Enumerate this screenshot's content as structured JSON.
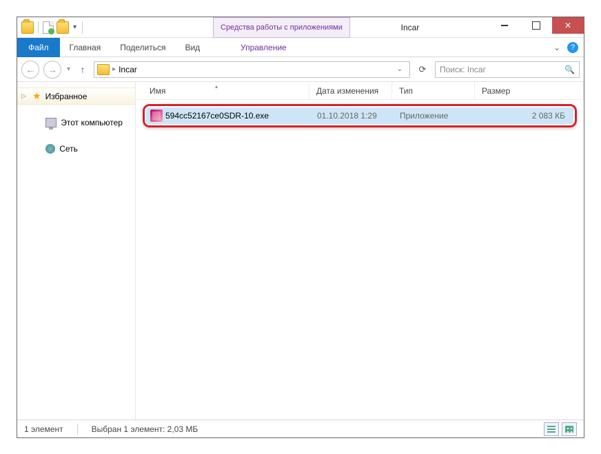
{
  "window": {
    "title": "Incar",
    "context_tab": "Средства работы с приложениями"
  },
  "ribbon": {
    "file": "Файл",
    "home": "Главная",
    "share": "Поделиться",
    "view": "Вид",
    "manage": "Управление"
  },
  "nav": {
    "breadcrumb": "Incar",
    "search_placeholder": "Поиск: Incar"
  },
  "sidebar": {
    "favorites": "Избранное",
    "this_pc": "Этот компьютер",
    "network": "Сеть"
  },
  "columns": {
    "name": "Имя",
    "date": "Дата изменения",
    "type": "Тип",
    "size": "Размер"
  },
  "file": {
    "name": "594cc52167ce0SDR-10.exe",
    "date": "01.10.2018 1:29",
    "type": "Приложение",
    "size": "2 083 КБ"
  },
  "status": {
    "count": "1 элемент",
    "selection": "Выбран 1 элемент: 2,03 МБ"
  }
}
